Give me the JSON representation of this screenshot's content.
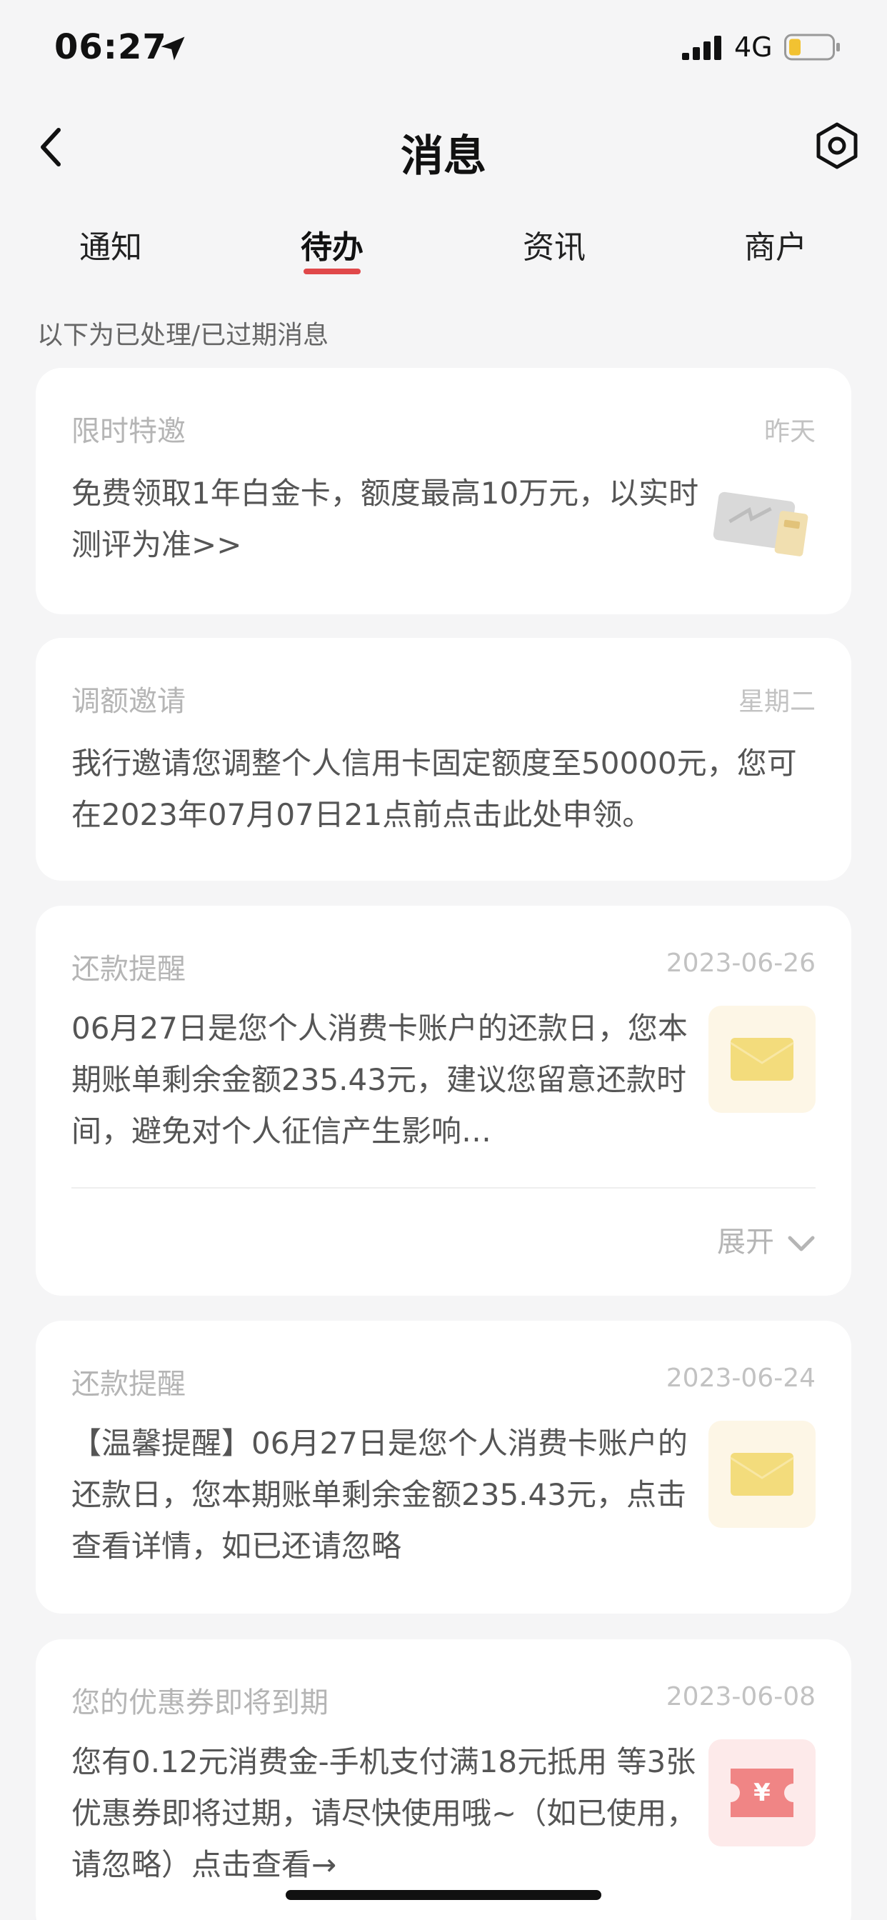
{
  "status_bar": {
    "time": "06:27",
    "network": "4G"
  },
  "header": {
    "title": "消息"
  },
  "tabs": [
    {
      "label": "通知",
      "active": false
    },
    {
      "label": "待办",
      "active": true
    },
    {
      "label": "资讯",
      "active": false
    },
    {
      "label": "商户",
      "active": false
    }
  ],
  "hint": "以下为已处理/已过期消息",
  "cards": [
    {
      "title": "限时特邀",
      "date": "昨天",
      "body": "免费领取1年白金卡，额度最高10万元，以实时测评为准>>",
      "thumb": "card-image"
    },
    {
      "title": "调额邀请",
      "date": "星期二",
      "body": "我行邀请您调整个人信用卡固定额度至50000元，您可在2023年07月07日21点前点击此处申领。"
    },
    {
      "title": "还款提醒",
      "date": "2023-06-26",
      "body": "06月27日是您个人消费卡账户的还款日，您本期账单剩余金额235.43元，建议您留意还款时间，避免对个人征信产生影响…",
      "thumb": "envelope-icon",
      "expand_label": "展开"
    },
    {
      "title": "还款提醒",
      "date": "2023-06-24",
      "body": "【温馨提醒】06月27日是您个人消费卡账户的还款日，您本期账单剩余金额235.43元，点击查看详情，如已还请忽略",
      "thumb": "envelope-icon"
    },
    {
      "title": "您的优惠券即将到期",
      "date": "2023-06-08",
      "body": "您有0.12元消费金-手机支付满18元抵用 等3张优惠券即将过期，请尽快使用哦~（如已使用，请忽略）点击查看→",
      "thumb": "coupon-icon"
    }
  ],
  "colors": {
    "accent": "#e0484a",
    "envelope": "#f3dc7c",
    "coupon": "#f08585"
  }
}
